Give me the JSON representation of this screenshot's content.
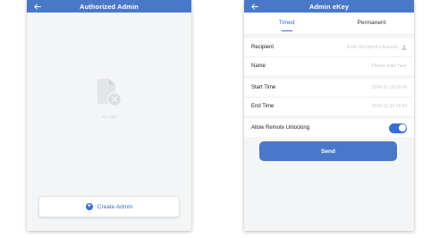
{
  "left": {
    "title": "Authorized Admin",
    "empty_text": "No Data",
    "create_button": "Create Admin"
  },
  "right": {
    "title": "Admin eKey",
    "tabs": [
      {
        "label": "Timed",
        "active": true
      },
      {
        "label": "Permanent",
        "active": false
      }
    ],
    "fields": {
      "recipient_label": "Recipient",
      "recipient_placeholder": "Enter Recipient's Account",
      "name_label": "Name",
      "name_placeholder": "Please enter here",
      "start_label": "Start Time",
      "start_value": "2024-11-19 16:04",
      "end_label": "End Time",
      "end_value": "2024-11-24 16:04",
      "remote_label": "Allow Remote Unlocking",
      "remote_enabled": true
    },
    "send_button": "Send"
  },
  "colors": {
    "primary": "#4a78c9",
    "accent": "#3a6fd1",
    "background": "#f4f5f7"
  }
}
